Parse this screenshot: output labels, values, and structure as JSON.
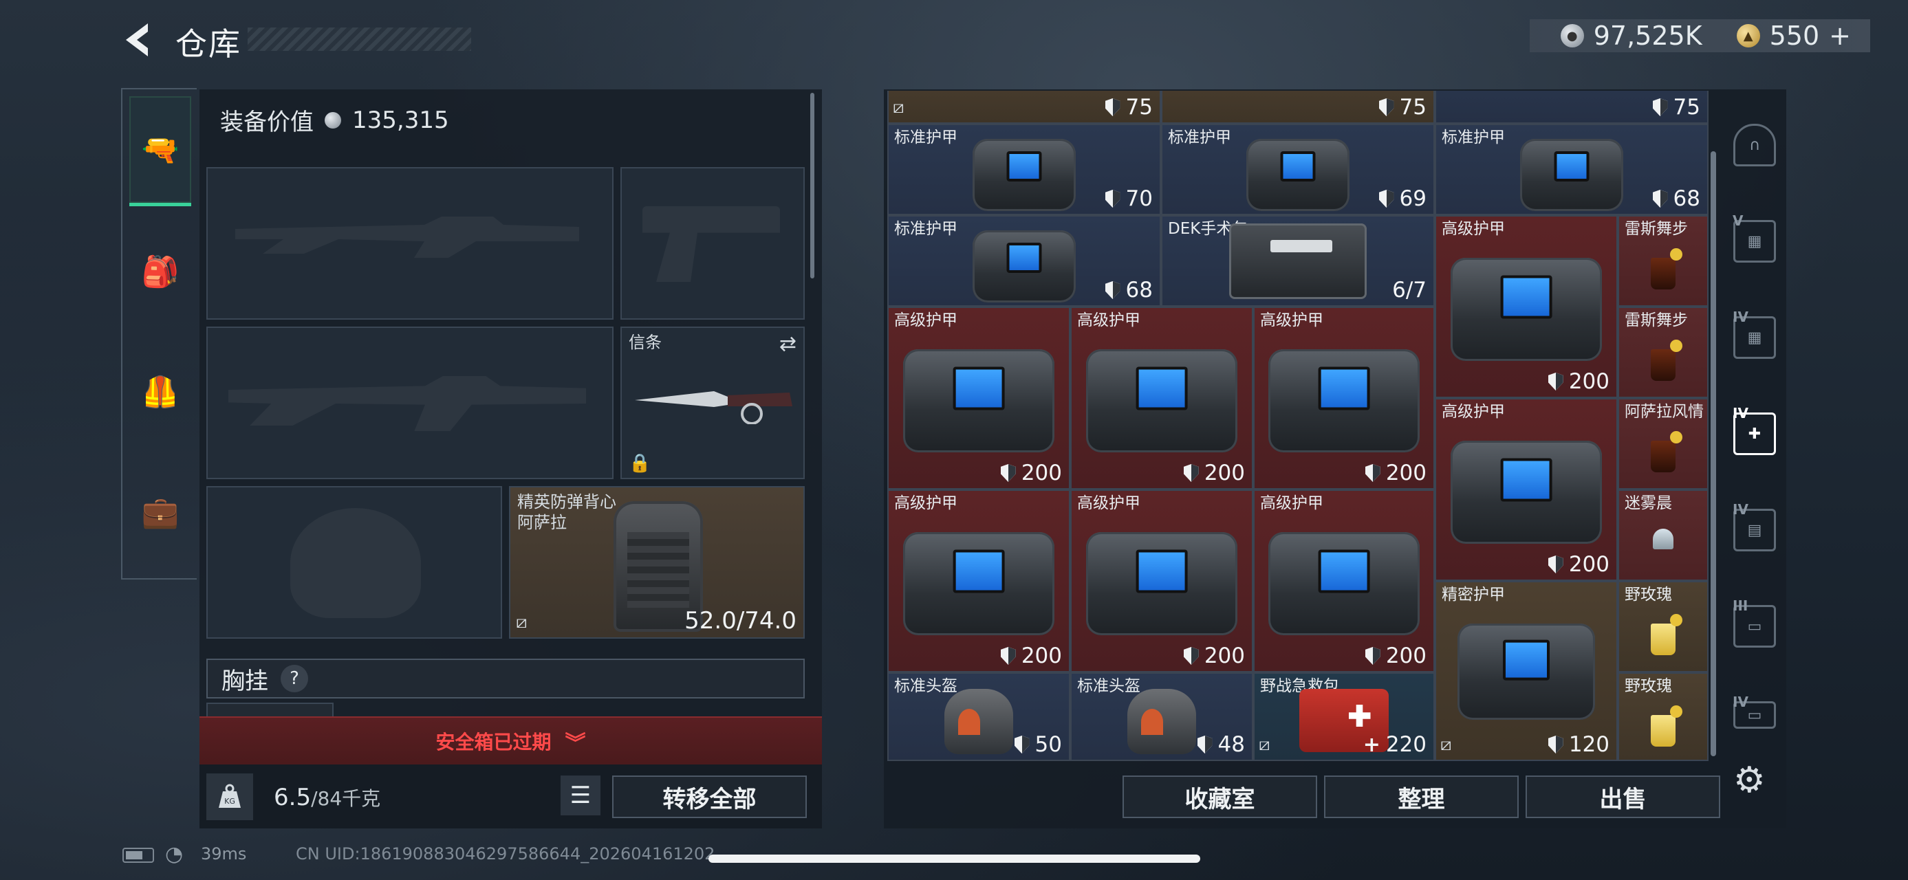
{
  "header": {
    "title": "仓库",
    "currency": [
      {
        "icon": "silver-coin-icon",
        "value": "97,525K"
      },
      {
        "icon": "gold-coin-icon",
        "value": "550",
        "plus": "+"
      }
    ]
  },
  "left_rail": [
    {
      "icon": "pistol-icon",
      "active": true
    },
    {
      "icon": "backpack-icon",
      "active": false
    },
    {
      "icon": "vest-icon",
      "active": false
    },
    {
      "icon": "briefcase-icon",
      "active": false
    }
  ],
  "equipment": {
    "value_label": "装备价值",
    "value": "135,315",
    "slots": {
      "primary_1": "",
      "pistol": "",
      "primary_2": "",
      "melee": {
        "label": "信条"
      },
      "helmet": "",
      "armor": {
        "label": "精英防弹背心\n阿萨拉",
        "durability": "52.0/74.0"
      }
    },
    "chest_rig_label": "胸挂",
    "chest_rig_help": "?",
    "safe_box": "安全箱已过期",
    "weight": "6.5",
    "weight_total": "/84千克",
    "kg_icon": "KG",
    "transfer_all": "转移全部"
  },
  "inventory": {
    "top_row": [
      "75",
      "75",
      "75"
    ],
    "items": [
      {
        "name": "标准护甲",
        "value": "70",
        "type": "armor"
      },
      {
        "name": "标准护甲",
        "value": "69",
        "type": "armor"
      },
      {
        "name": "标准护甲",
        "value": "68",
        "type": "armor"
      },
      {
        "name": "标准护甲",
        "value": "68",
        "type": "armor"
      },
      {
        "name": "DEK手术包",
        "value": "6/7",
        "type": "medkit"
      },
      {
        "name": "高级护甲",
        "value": "200",
        "type": "armor"
      },
      {
        "name": "雷斯舞步",
        "value": "",
        "type": "drink"
      },
      {
        "name": "雷斯舞步",
        "value": "",
        "type": "drink"
      },
      {
        "name": "高级护甲",
        "value": "200",
        "type": "armor"
      },
      {
        "name": "高级护甲",
        "value": "200",
        "type": "armor"
      },
      {
        "name": "高级护甲",
        "value": "200",
        "type": "armor"
      },
      {
        "name": "高级护甲",
        "value": "200",
        "type": "armor"
      },
      {
        "name": "阿萨拉风情",
        "value": "",
        "type": "drink"
      },
      {
        "name": "迷雾晨",
        "value": "",
        "type": "drink"
      },
      {
        "name": "高级护甲",
        "value": "200",
        "type": "armor"
      },
      {
        "name": "高级护甲",
        "value": "200",
        "type": "armor"
      },
      {
        "name": "高级护甲",
        "value": "200",
        "type": "armor"
      },
      {
        "name": "精密护甲",
        "value": "120",
        "type": "armor"
      },
      {
        "name": "野玫瑰",
        "value": "",
        "type": "drink"
      },
      {
        "name": "野玫瑰",
        "value": "",
        "type": "drink"
      },
      {
        "name": "标准头盔",
        "value": "50",
        "type": "helmet"
      },
      {
        "name": "标准头盔",
        "value": "48",
        "type": "helmet"
      },
      {
        "name": "野战急救包",
        "value": "220",
        "type": "firstaid"
      }
    ],
    "buttons": {
      "collection": "收藏室",
      "sort": "整理",
      "sell": "出售"
    }
  },
  "right_rail": [
    {
      "icon": "gate-icon",
      "level": ""
    },
    {
      "icon": "case-icon",
      "level": "V"
    },
    {
      "icon": "case-icon",
      "level": "IV"
    },
    {
      "icon": "medical-case-icon",
      "level": "IV"
    },
    {
      "icon": "folder-case-icon",
      "level": "IV"
    },
    {
      "icon": "gun-case-icon",
      "level": "III"
    },
    {
      "icon": "gun-case-icon",
      "level": "IV"
    }
  ],
  "status_bar": {
    "ping": "39ms",
    "uid": "CN UID:1861908830462975866​44_202604161202"
  },
  "colors": {
    "accent": "#39d29a",
    "danger": "#ff4a4a",
    "tier_red": "#5c2426",
    "tier_blue": "#2b3850",
    "tier_gold": "#4d4030"
  }
}
